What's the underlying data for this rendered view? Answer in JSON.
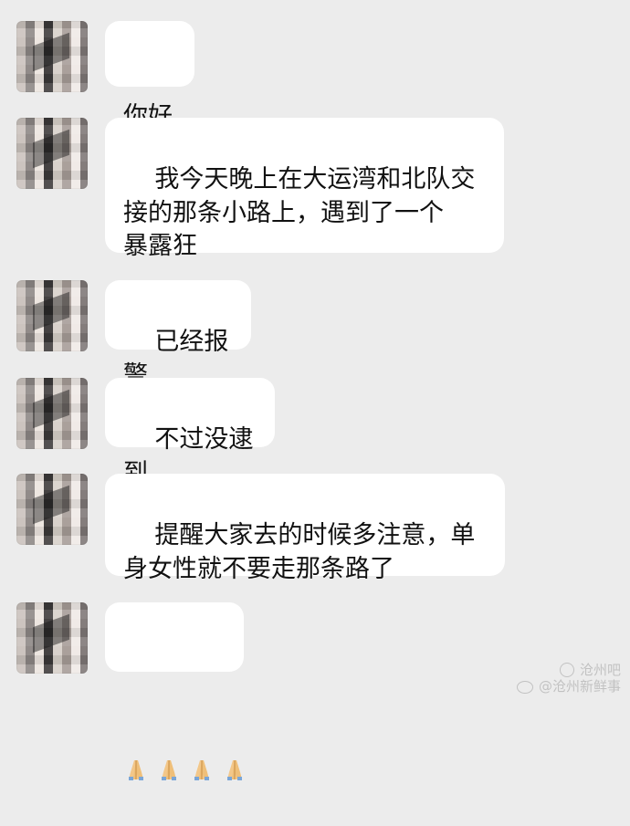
{
  "messages": [
    {
      "text": "你好"
    },
    {
      "text": "我今天晚上在大运湾和北队交\n接的那条小路上，遇到了一个\n暴露狂"
    },
    {
      "text": "已经报警"
    },
    {
      "text": "不过没逮到"
    },
    {
      "text": "提醒大家去的时候多注意，单\n身女性就不要走那条路了"
    },
    {
      "icon": "folded-hands-emoji",
      "count": 4
    }
  ],
  "watermark": {
    "line1": "沧州吧",
    "line2": "@沧州新鲜事",
    "icon1": "wechat-icon",
    "icon2": "weibo-icon"
  }
}
